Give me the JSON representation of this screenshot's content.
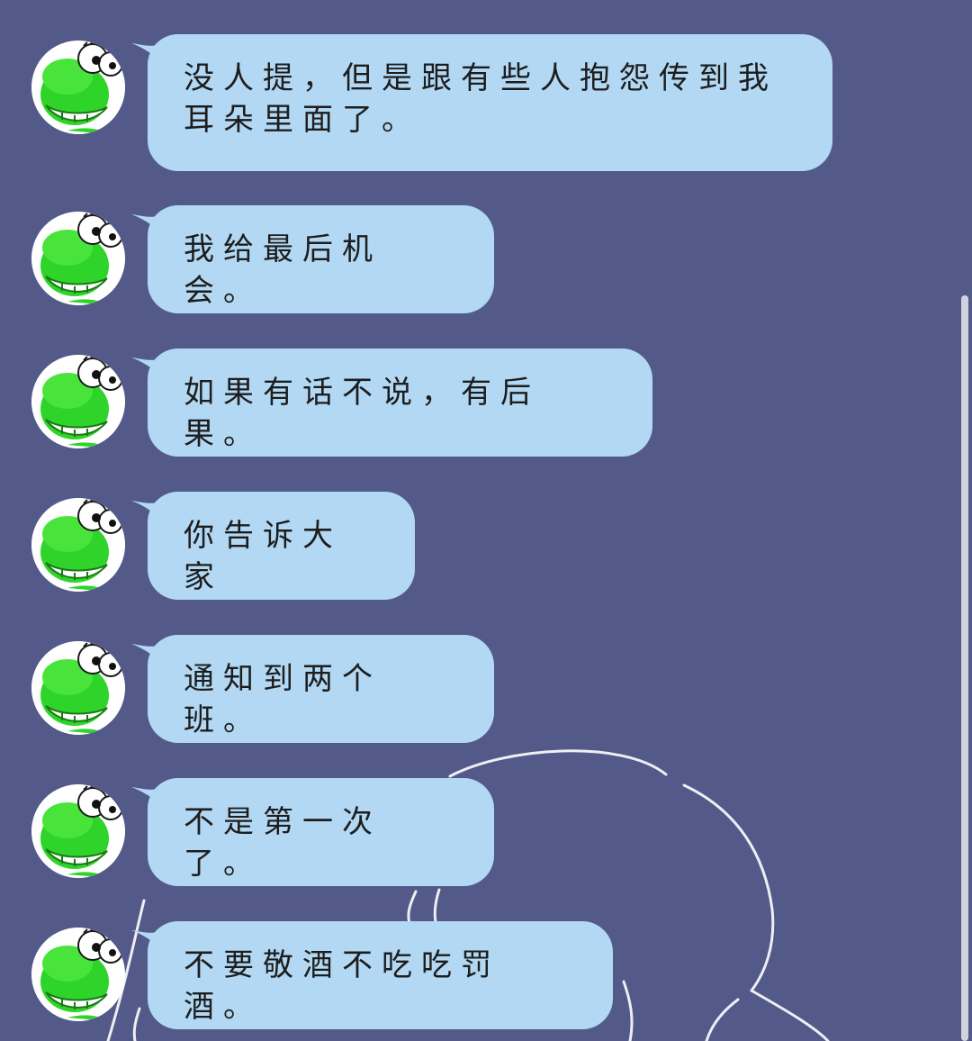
{
  "chat": {
    "avatar_icon": "green-frog-cartoon-avatar",
    "bubble_color": "#b2d8f3",
    "background_color": "#535a89",
    "messages": [
      {
        "sender": "contact",
        "line1": "没人提，但是跟有些人抱怨传到我",
        "line2": "耳朵里面了。"
      },
      {
        "sender": "contact",
        "line1": "我给最后机会。"
      },
      {
        "sender": "contact",
        "line1": "如果有话不说，有后果。"
      },
      {
        "sender": "contact",
        "line1": "你告诉大家"
      },
      {
        "sender": "contact",
        "line1": "通知到两个班。"
      },
      {
        "sender": "contact",
        "line1": "不是第一次了。"
      },
      {
        "sender": "contact",
        "line1": "不要敬酒不吃吃罚酒。"
      }
    ]
  }
}
